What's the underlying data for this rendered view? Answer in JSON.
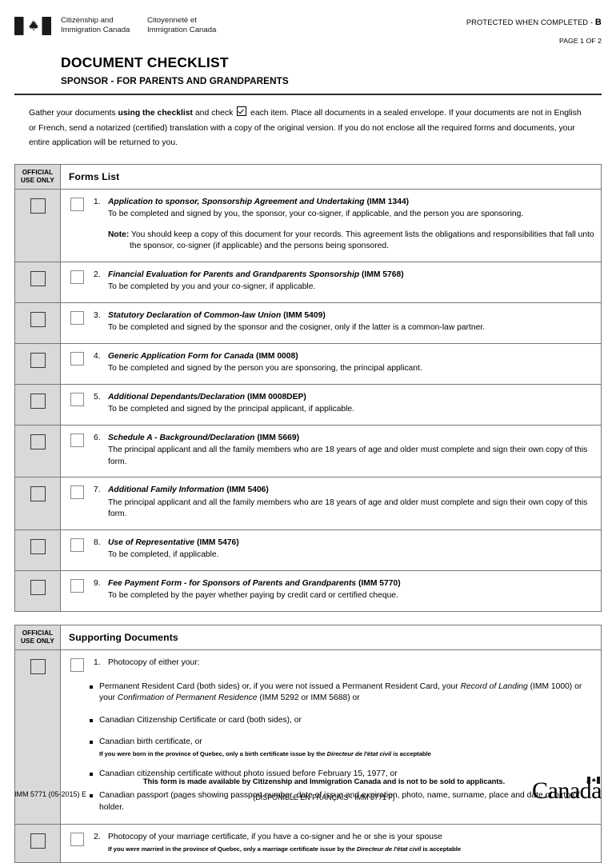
{
  "header": {
    "flag_icon": "canada-flag-icon",
    "dept_en_line1": "Citizenship and",
    "dept_en_line2": "Immigration Canada",
    "dept_fr_line1": "Citoyenneté et",
    "dept_fr_line2": "Immigration Canada",
    "protected_label": "PROTECTED WHEN COMPLETED - ",
    "protected_level": "B",
    "page_of": "PAGE 1 OF 2"
  },
  "title": {
    "main": "DOCUMENT CHECKLIST",
    "sub": "SPONSOR - FOR PARENTS AND GRANDPARENTS"
  },
  "intro": {
    "part1": "Gather your documents ",
    "bold1": "using the checklist",
    "part2": " and check ",
    "checkbox_icon": "checked-checkbox-icon",
    "part3": " each item. Place all documents in a sealed envelope. If your documents are not in English or French, send a notarized (certified) translation with a copy of the original version. If you do not enclose all the required forms and documents, your entire application will be returned to you."
  },
  "official_use_header": {
    "line1": "OFFICIAL",
    "line2": "USE ONLY"
  },
  "forms_section": {
    "title": "Forms List",
    "items": [
      {
        "num": "1.",
        "name": "Application to sponsor, Sponsorship Agreement and Undertaking",
        "code": "(IMM 1344)",
        "desc": "To be completed and signed by you, the sponsor, your co-signer, if applicable, and the person you are sponsoring.",
        "note_label": "Note:",
        "note_text": " You should keep a copy of this document for your records. This agreement lists the obligations and responsibilities that fall unto",
        "note_cont": "the sponsor, co-signer (if applicable) and the persons being sponsored."
      },
      {
        "num": "2.",
        "name": "Financial Evaluation for Parents and Grandparents Sponsorship",
        "code": "(IMM 5768)",
        "desc": "To be completed by you and your co-signer, if applicable."
      },
      {
        "num": "3.",
        "name": "Statutory Declaration of Common-law Union",
        "code": "(IMM 5409)",
        "desc": "To be completed and signed by the sponsor and the cosigner, only if the latter is a common-law partner."
      },
      {
        "num": "4.",
        "name": "Generic Application Form for Canada",
        "code": "(IMM 0008)",
        "desc": "To be completed and signed by the person you are sponsoring, the principal applicant."
      },
      {
        "num": "5.",
        "name": "Additional Dependants/Declaration",
        "code": "(IMM 0008DEP)",
        "desc": "To be completed and signed by the principal applicant, if applicable."
      },
      {
        "num": "6.",
        "name": "Schedule A - Background/Declaration",
        "code": "(IMM 5669)",
        "desc": "The principal applicant and all the family members who are 18 years of age and older must complete and sign their own copy of this form."
      },
      {
        "num": "7.",
        "name": "Additional Family Information",
        "code": "(IMM 5406)",
        "desc": "The principal applicant and all the family members who are 18 years of age and older must complete and sign their own copy of this form."
      },
      {
        "num": "8.",
        "name": "Use of Representative",
        "code": "(IMM 5476)",
        "desc": "To be completed, if applicable."
      },
      {
        "num": "9.",
        "name": "Fee Payment Form - for Sponsors of Parents and Grandparents",
        "code": "(IMM 5770)",
        "desc": "To be completed by the payer whether paying by credit card or certified cheque."
      }
    ]
  },
  "supporting_section": {
    "title": "Supporting Documents",
    "item1": {
      "num": "1.",
      "lead": "Photocopy of either your:",
      "bullets": [
        {
          "text_a": "Permanent Resident Card (both sides) or, if you were not issued a Permanent Resident Card, your ",
          "italic_a": "Record of Landing",
          "text_b": " (IMM 1000) or your ",
          "italic_b": "Confirmation of Permanent Residence",
          "text_c": " (IMM 5292 or IMM 5688) or"
        },
        {
          "text_a": "Canadian Citizenship Certificate or card (both sides), or"
        },
        {
          "text_a": "Canadian birth certificate, or",
          "fine_a": "If you were born in the province of Quebec, only a birth certificate issue by the ",
          "fine_italic": "Directeur de l'état civil",
          "fine_b": " is acceptable"
        },
        {
          "text_a": "Canadian citizenship certificate without photo issued before February 15, 1977, or"
        },
        {
          "text_a": "Canadian passport (pages showing passport number, date of issue and expiration, photo, name, surname, place and date of birth of holder."
        }
      ]
    },
    "item2": {
      "num": "2.",
      "text": "Photocopy of your marriage certificate, if you have a co-signer and he or she is your spouse",
      "fine_a": "If you were married in the province of Quebec, only a marriage certificate issue by the ",
      "fine_italic": "Directeur de l'état civil",
      "fine_b": " is acceptable"
    }
  },
  "footer": {
    "form_id": "IMM 5771 (05-2015) E",
    "line1": "This form is made available by Citizenship and Immigration Canada and is not to be sold to applicants.",
    "line2": "(DISPONIBLE EN FRANÇAIS - IMM 5771 F)",
    "wordmark": "Canada",
    "wordmark_flag_icon": "canada-flag-icon"
  },
  "colors": {
    "official_gray": "#d9d9d9",
    "border": "#777777",
    "text": "#000000"
  }
}
